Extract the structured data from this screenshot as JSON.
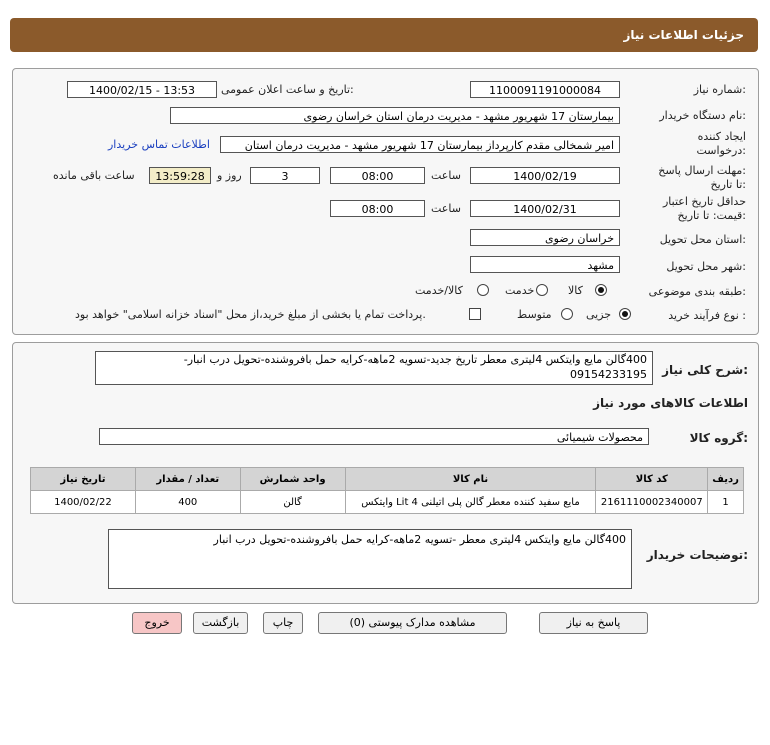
{
  "header": {
    "title": "جزئیات اطلاعات نیاز"
  },
  "form": {
    "need_number_label": "شماره نیاز:",
    "need_number": "1100091191000084",
    "announce_label": "تاریخ و ساعت اعلان عمومی:",
    "announce_value": "1400/02/15 - 13:53",
    "buyer_org_label": "نام دستگاه خریدار:",
    "buyer_org": "بیمارستان 17 شهریور مشهد - مدیریت درمان استان خراسان رضوی",
    "creator_label_1": "ایجاد کننده",
    "creator_label_2": "درخواست:",
    "creator": "امیر  شمخالی مقدم کارپرداز بیمارستان 17 شهریور مشهد - مدیریت درمان استان",
    "contact_link": "اطلاعات تماس خریدار",
    "deadline_label_1": "مهلت ارسال پاسخ:",
    "deadline_label_2": "تا تاریخ:",
    "deadline_date": "1400/02/19",
    "time_label": "ساعت",
    "deadline_time": "08:00",
    "days_value": "3",
    "days_label": "روز و",
    "remaining_time": "13:59:28",
    "remaining_label": "ساعت باقی مانده",
    "validity_label_1": "حداقل تاریخ اعتبار",
    "validity_label_2": "قیمت: تا تاریخ:",
    "validity_date": "1400/02/31",
    "validity_time_label": "ساعت",
    "validity_time": "08:00",
    "province_label": "استان محل تحویل:",
    "province": "خراسان رضوی",
    "city_label": "شهر محل تحویل:",
    "city": "مشهد",
    "category_label": "طبقه بندی موضوعی:",
    "category_options": [
      "کالا",
      "خدمت",
      "کالا/خدمت"
    ],
    "category_selected": "کالا",
    "process_label": "نوع فرآیند خرید :",
    "process_options": [
      "جزیی",
      "متوسط"
    ],
    "process_selected": "جزیی",
    "payment_note": "پرداخت تمام یا بخشی از مبلغ خرید،از محل \"اسناد خزانه اسلامی\" خواهد بود."
  },
  "description": {
    "label": "شرح کلی نیاز:",
    "line1": "400گالن مایع وایتکس 4لیتری معطر تاریخ جدید-تسویه 2ماهه-کرایه حمل بافروشنده-تحویل درب انبار-",
    "line2": "09154233195"
  },
  "goods": {
    "section_title": "اطلاعات کالاهای مورد نیاز",
    "group_label": "گروه کالا:",
    "group_value": "محصولات شیمیائی",
    "columns": [
      "ردیف",
      "کد کالا",
      "نام کالا",
      "واحد شمارش",
      "تعداد / مقدار",
      "تاریخ نیاز"
    ],
    "rows": [
      [
        "1",
        "2161110002340007",
        "مایع سفید کننده معطر گالن پلی اتیلنی Lit 4 وایتکس",
        "گالن",
        "400",
        "1400/02/22"
      ]
    ]
  },
  "buyer_notes": {
    "label": "توضیحات خریدار:",
    "text": "400گالن مایع وایتکس 4لیتری معطر -تسویه 2ماهه-کرایه حمل بافروشنده-تحویل درب انبار"
  },
  "buttons": {
    "reply": "پاسخ به نیاز",
    "attachments": "مشاهده مدارک پیوستی (0)",
    "print": "چاپ",
    "back": "بازگشت",
    "exit": "خروج"
  },
  "colors": {
    "header_bg": "#8b5a2b",
    "exit_bg": "#f7c6c6",
    "remaining_bg": "#f3edc8"
  }
}
